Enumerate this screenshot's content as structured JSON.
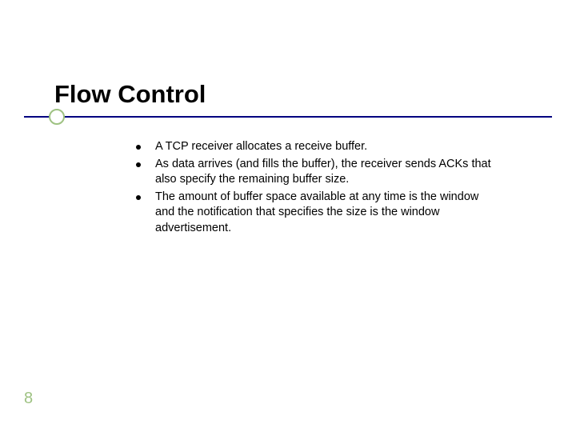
{
  "slide": {
    "title": "Flow Control",
    "bullets": [
      "A TCP receiver allocates a receive buffer.",
      "As data arrives (and fills the buffer), the receiver sends ACKs that also specify the remaining buffer size.",
      "The amount of buffer space available at any time is the window and the notification that specifies the size is the window advertisement."
    ],
    "page_number": "8"
  },
  "colors": {
    "accent_green": "#9EC282",
    "line_navy": "#000080"
  }
}
